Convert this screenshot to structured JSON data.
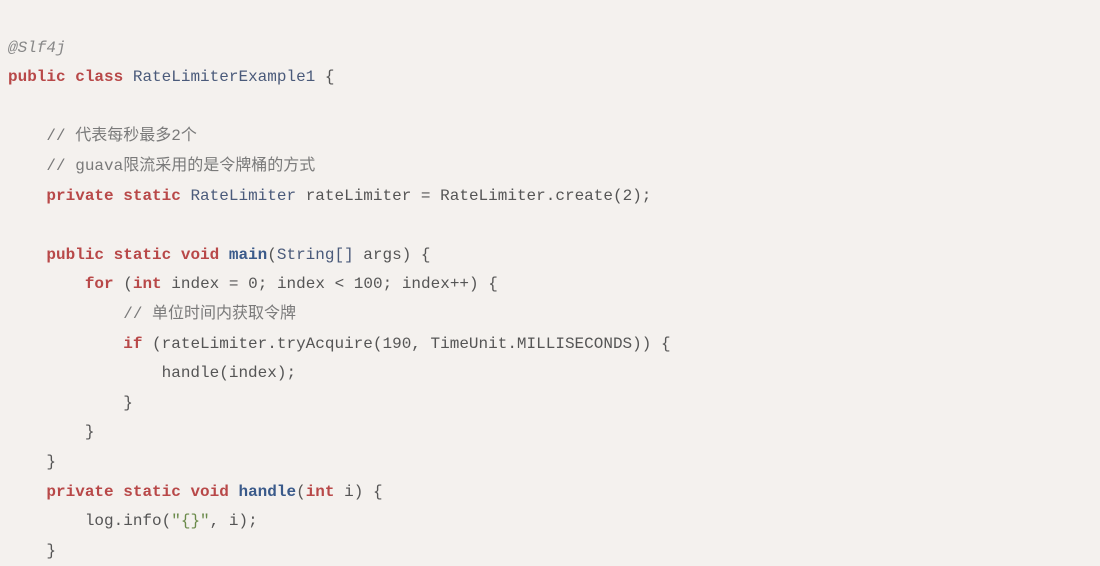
{
  "code": {
    "line1": {
      "annotation": "@Slf4j"
    },
    "line2": {
      "kw_public": "public",
      "kw_class": "class",
      "classname": "RateLimiterExample1",
      "brace": "{"
    },
    "line3_blank": "",
    "line4": {
      "indent": "    ",
      "comment": "// 代表每秒最多2个"
    },
    "line5": {
      "indent": "    ",
      "comment": "// guava限流采用的是令牌桶的方式"
    },
    "line6": {
      "indent": "    ",
      "kw_private": "private",
      "kw_static": "static",
      "type": "RateLimiter",
      "ident": "rateLimiter",
      "op": "=",
      "call": "RateLimiter.create",
      "lp": "(",
      "arg": "2",
      "rp": ")",
      "semi": ";"
    },
    "line7_blank": "",
    "line8": {
      "indent": "    ",
      "kw_public": "public",
      "kw_static": "static",
      "kw_void": "void",
      "method": "main",
      "lp": "(",
      "param_type": "String[]",
      "param_name": "args",
      "rp": ")",
      "brace": "{"
    },
    "line9": {
      "indent": "        ",
      "kw_for": "for",
      "lp": "(",
      "kw_int": "int",
      "var": "index",
      "op1": "=",
      "zero": "0",
      "semi1": ";",
      "cond_var": "index",
      "lt": "<",
      "hundred": "100",
      "semi2": ";",
      "inc": "index++",
      "rp": ")",
      "brace": "{"
    },
    "line10": {
      "indent": "            ",
      "comment": "// 单位时间内获取令牌"
    },
    "line11": {
      "indent": "            ",
      "kw_if": "if",
      "lp": "(",
      "call": "rateLimiter.tryAcquire",
      "lp2": "(",
      "arg1": "190",
      "comma": ",",
      "arg2": "TimeUnit.MILLISECONDS",
      "rp2": ")",
      "rp": ")",
      "brace": "{"
    },
    "line12": {
      "indent": "                ",
      "call": "handle",
      "lp": "(",
      "arg": "index",
      "rp": ")",
      "semi": ";"
    },
    "line13": {
      "indent": "            ",
      "brace": "}"
    },
    "line14": {
      "indent": "        ",
      "brace": "}"
    },
    "line15": {
      "indent": "    ",
      "brace": "}"
    },
    "line16": {
      "indent": "    ",
      "kw_private": "private",
      "kw_static": "static",
      "kw_void": "void",
      "method": "handle",
      "lp": "(",
      "param_type": "int",
      "param_name": "i",
      "rp": ")",
      "brace": "{"
    },
    "line17": {
      "indent": "        ",
      "call": "log.info",
      "lp": "(",
      "str": "\"{}\"",
      "comma": ",",
      "arg": "i",
      "rp": ")",
      "semi": ";"
    },
    "line18": {
      "indent": "    ",
      "brace": "}"
    }
  }
}
